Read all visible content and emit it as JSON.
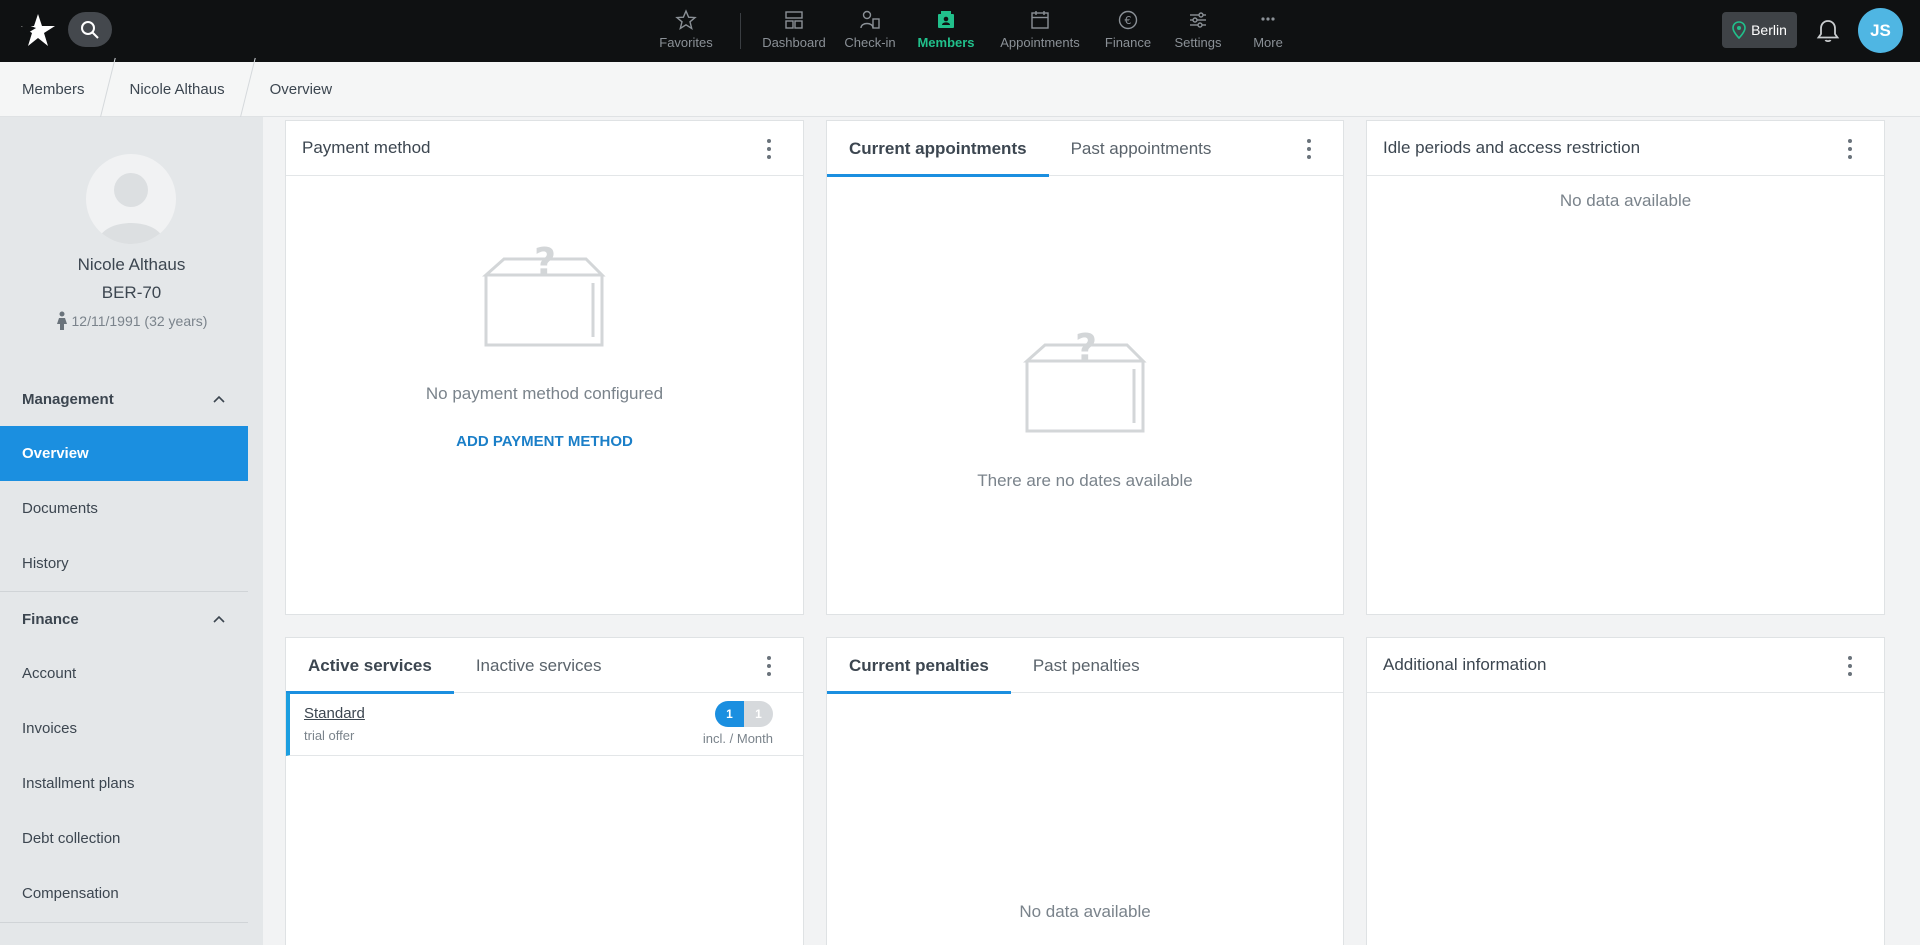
{
  "topbar": {
    "nav": [
      {
        "label": "Favorites",
        "icon": "star-icon"
      },
      {
        "label": "Dashboard",
        "icon": "dashboard-icon"
      },
      {
        "label": "Check-in",
        "icon": "check-in-icon"
      },
      {
        "label": "Members",
        "icon": "members-icon",
        "active": true
      },
      {
        "label": "Appointments",
        "icon": "calendar-icon"
      },
      {
        "label": "Finance",
        "icon": "euro-icon"
      },
      {
        "label": "Settings",
        "icon": "sliders-icon"
      },
      {
        "label": "More",
        "icon": "more-icon"
      }
    ],
    "location": "Berlin",
    "user_initials": "JS",
    "accent_color": "#21c08b"
  },
  "breadcrumb": [
    "Members",
    "Nicole Althaus",
    "Overview"
  ],
  "profile": {
    "name": "Nicole Althaus",
    "member_id": "BER-70",
    "dob": "12/11/1991 (32 years)"
  },
  "sidebar": {
    "management": {
      "title": "Management",
      "items": [
        "Overview",
        "Documents",
        "History"
      ]
    },
    "finance": {
      "title": "Finance",
      "items": [
        "Account",
        "Invoices",
        "Installment plans",
        "Debt collection",
        "Compensation"
      ]
    }
  },
  "cards": {
    "payment": {
      "title": "Payment method",
      "empty": "No payment method configured",
      "action": "ADD PAYMENT METHOD"
    },
    "appointments": {
      "tab_current": "Current appointments",
      "tab_past": "Past appointments",
      "empty": "There are no dates available"
    },
    "idle": {
      "title": "Idle periods and access restriction",
      "empty": "No data available"
    },
    "services": {
      "tab_active": "Active services",
      "tab_inactive": "Inactive services",
      "service_name": "Standard",
      "service_sub": "trial offer",
      "badge_a": "1",
      "badge_b": "1",
      "frequency": "incl. / Month"
    },
    "penalties": {
      "tab_current": "Current penalties",
      "tab_past": "Past penalties",
      "empty": "No data available"
    },
    "additional": {
      "title": "Additional information"
    }
  },
  "colors": {
    "primary": "#1b8fe0",
    "topbar": "#0f1112"
  }
}
